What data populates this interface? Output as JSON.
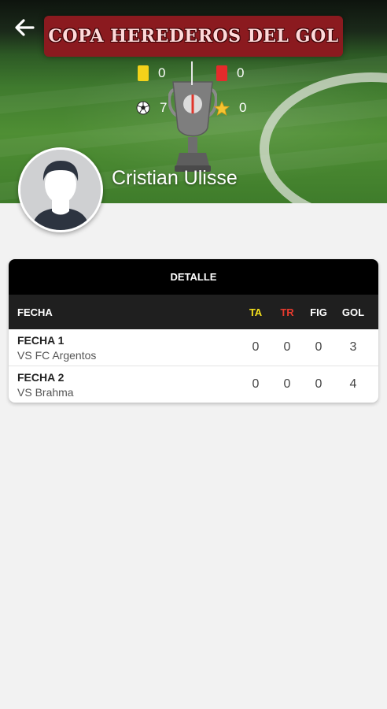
{
  "header": {
    "title": "COPA HEREDEROS DEL GOL",
    "back_icon": "arrow-left-icon"
  },
  "stats": {
    "yellow_cards": "0",
    "red_cards": "0",
    "goals": "7",
    "mvp": "0"
  },
  "player": {
    "name": "Cristian Ulisse"
  },
  "detail": {
    "title": "DETALLE",
    "columns": {
      "fecha": "FECHA",
      "ta": "TA",
      "tr": "TR",
      "fig": "FIG",
      "gol": "GOL"
    },
    "rows": [
      {
        "fecha": "FECHA 1",
        "rival": "VS FC Argentos",
        "ta": "0",
        "tr": "0",
        "fig": "0",
        "gol": "3"
      },
      {
        "fecha": "FECHA 2",
        "rival": "VS Brahma",
        "ta": "0",
        "tr": "0",
        "fig": "0",
        "gol": "4"
      }
    ]
  },
  "colors": {
    "ta": "#f5e11c",
    "tr": "#e63a2e",
    "banner": "#8b1a1f"
  }
}
